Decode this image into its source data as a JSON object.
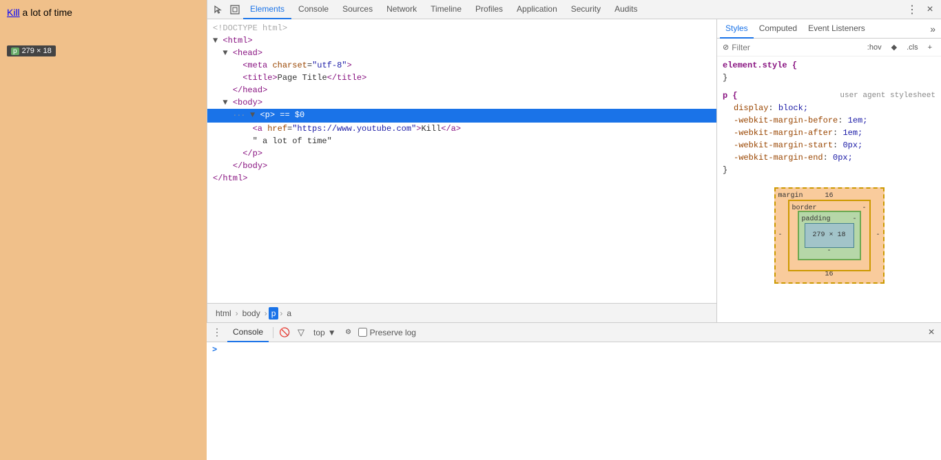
{
  "browser": {
    "page_bg": "#f0c08a",
    "link_text": "Kill",
    "link_href": "https://www.youtube.com",
    "page_text": " a lot of time",
    "tooltip": {
      "badge": "p",
      "size": "279 × 18"
    }
  },
  "devtools": {
    "tabs": [
      {
        "label": "Elements",
        "active": true
      },
      {
        "label": "Console",
        "active": false
      },
      {
        "label": "Sources",
        "active": false
      },
      {
        "label": "Network",
        "active": false
      },
      {
        "label": "Timeline",
        "active": false
      },
      {
        "label": "Profiles",
        "active": false
      },
      {
        "label": "Application",
        "active": false
      },
      {
        "label": "Security",
        "active": false
      },
      {
        "label": "Audits",
        "active": false
      }
    ],
    "html_lines": [
      {
        "indent": 0,
        "content": "<!DOCTYPE html>",
        "type": "comment"
      },
      {
        "indent": 0,
        "content": "▼ <html>",
        "type": "tag"
      },
      {
        "indent": 1,
        "content": "▼ <head>",
        "type": "tag"
      },
      {
        "indent": 2,
        "content": "  <meta charset=\"utf-8\">",
        "type": "tag"
      },
      {
        "indent": 2,
        "content": "  <title>Page Title</title>",
        "type": "tag"
      },
      {
        "indent": 1,
        "content": "  </head>",
        "type": "tag"
      },
      {
        "indent": 1,
        "content": "▼ <body>",
        "type": "tag"
      },
      {
        "indent": 2,
        "content": "  ▼ <p> == $0",
        "type": "selected"
      },
      {
        "indent": 3,
        "content": "    <a href=\"https://www.youtube.com\">Kill</a>",
        "type": "tag"
      },
      {
        "indent": 3,
        "content": "    \" a lot of time\"",
        "type": "text"
      },
      {
        "indent": 2,
        "content": "    </p>",
        "type": "tag"
      },
      {
        "indent": 1,
        "content": "  </body>",
        "type": "tag"
      },
      {
        "indent": 0,
        "content": "</html>",
        "type": "tag"
      }
    ],
    "breadcrumb": {
      "items": [
        "html",
        "body",
        "p",
        "a"
      ]
    }
  },
  "styles": {
    "tabs": [
      {
        "label": "Styles",
        "active": true
      },
      {
        "label": "Computed",
        "active": false
      },
      {
        "label": "Event Listeners",
        "active": false
      }
    ],
    "filter_placeholder": "Filter",
    "filter_pseudo": ":hov",
    "filter_diamond": "◆",
    "filter_cls": ".cls",
    "filter_plus": "+",
    "rules": [
      {
        "selector": "element.style {",
        "close": "}",
        "source": "",
        "properties": []
      },
      {
        "selector": "p {",
        "close": "}",
        "source": "user agent stylesheet",
        "properties": [
          {
            "prop": "display",
            "val": "block;"
          },
          {
            "prop": "-webkit-margin-before",
            "val": "1em;"
          },
          {
            "prop": "-webkit-margin-after",
            "val": "1em;"
          },
          {
            "prop": "-webkit-margin-start",
            "val": "0px;"
          },
          {
            "prop": "-webkit-margin-end",
            "val": "0px;"
          }
        ]
      }
    ],
    "box_model": {
      "margin_label": "margin",
      "border_label": "border",
      "padding_label": "padding",
      "content_label": "279 × 18",
      "margin_top": "16",
      "margin_bottom": "16",
      "margin_left": "-",
      "margin_right": "-",
      "border_val": "-",
      "padding_val": "-",
      "content_left": "-",
      "content_right": "-",
      "content_top": "-",
      "content_bottom": "-"
    }
  },
  "console": {
    "tab_label": "Console",
    "top_label": "top",
    "preserve_log": "Preserve log",
    "prompt_caret": ">"
  },
  "icons": {
    "cursor": "⬚",
    "box": "⬜",
    "more": "⋮",
    "close": "×",
    "clear": "🚫",
    "filter": "▽",
    "down_arrow": "▼"
  }
}
